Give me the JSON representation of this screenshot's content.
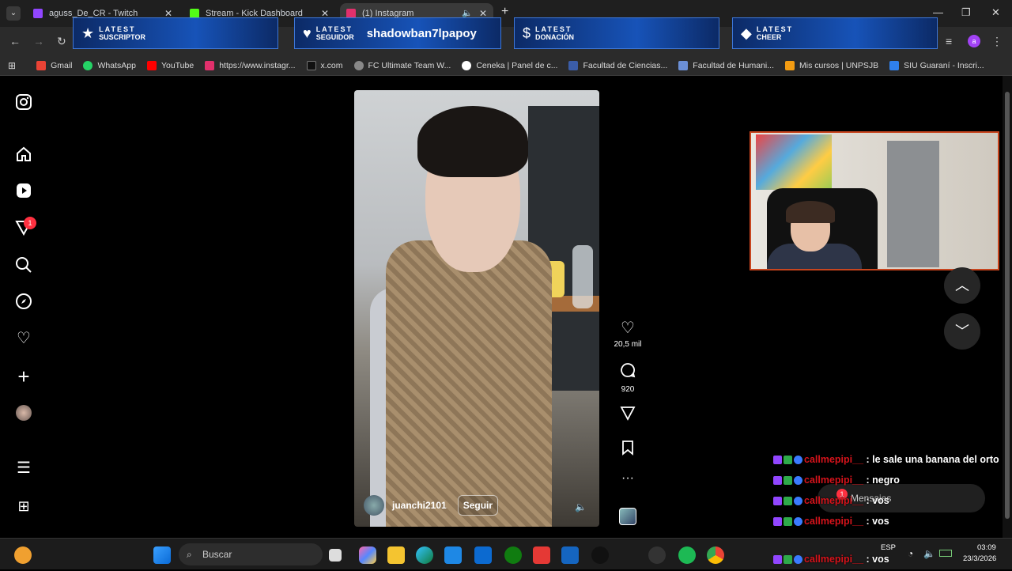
{
  "browser": {
    "tabs": [
      {
        "title": "aguss_De_CR - Twitch",
        "color": "#9146ff"
      },
      {
        "title": "Stream - Kick Dashboard",
        "color": "#53fc18"
      },
      {
        "title": "(1) Instagram",
        "color": "#e1306c"
      }
    ],
    "new_tab": "+",
    "window_controls": {
      "minimize": "—",
      "maximize": "❐",
      "close": "✕"
    }
  },
  "overlay": {
    "widgets": [
      {
        "top": "LATEST",
        "bottom": "SUSCRIPTOR",
        "icon": "★",
        "value": ""
      },
      {
        "top": "LATEST",
        "bottom": "SEGUIDOR",
        "icon": "♥",
        "value": "shadowban7lpapoy"
      },
      {
        "top": "LATEST",
        "bottom": "DONACIÓN",
        "icon": "$",
        "value": ""
      },
      {
        "top": "LATEST",
        "bottom": "CHEER",
        "icon": "◆",
        "value": ""
      }
    ]
  },
  "bookmarks": [
    {
      "label": "Gmail",
      "color": "#ea4335"
    },
    {
      "label": "WhatsApp",
      "color": "#25d366"
    },
    {
      "label": "YouTube",
      "color": "#ff0000"
    },
    {
      "label": "https://www.instagr...",
      "color": "#e1306c"
    },
    {
      "label": "x.com",
      "color": "#111111"
    },
    {
      "label": "FC Ultimate Team W...",
      "color": "#888888"
    },
    {
      "label": "Ceneka | Panel de c...",
      "color": "#ffffff"
    },
    {
      "label": "Facultad de Ciencias...",
      "color": "#3b5da8"
    },
    {
      "label": "Facultad de Humani...",
      "color": "#6b8fd6"
    },
    {
      "label": "Mis cursos | UNPSJB",
      "color": "#f39c12"
    },
    {
      "label": "SIU Guaraní - Inscri...",
      "color": "#2f80ed"
    }
  ],
  "sidenav": {
    "notification_count": "1"
  },
  "reel": {
    "username": "juanchi2101",
    "follow_label": "Seguir",
    "likes": "20,5 mil",
    "comments": "920",
    "more": "···"
  },
  "messages_label": "Mensajes",
  "messages_badge": "1",
  "chat": [
    {
      "name": "callmepipi__",
      "text": " : le sale una banana del orto"
    },
    {
      "name": "callmepipi__",
      "text": " : negro"
    },
    {
      "name": "callmepipi__",
      "text": " : vos"
    },
    {
      "name": "callmepipi__",
      "text": " : vos"
    },
    {
      "name": "callmepipi__",
      "text": " : vos"
    }
  ],
  "taskbar": {
    "search_placeholder": "Buscar",
    "lang": "ESP",
    "time": "03:09",
    "date": "23/3/2026"
  }
}
